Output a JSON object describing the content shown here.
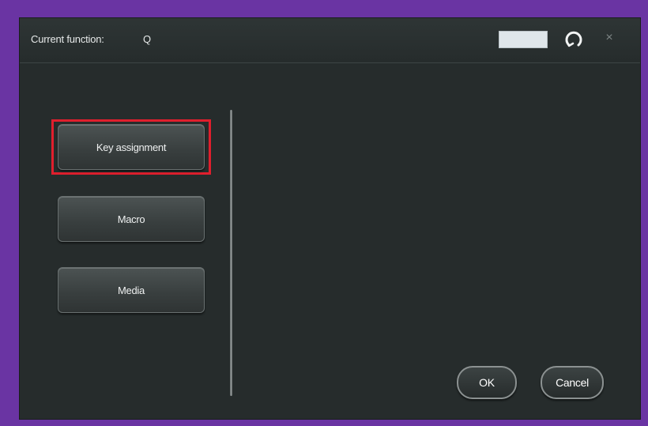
{
  "titlebar": {
    "label": "Current function:",
    "value": "Q"
  },
  "sidebar": {
    "items": [
      {
        "label": "Key assignment"
      },
      {
        "label": "Macro"
      },
      {
        "label": "Media"
      }
    ]
  },
  "footer": {
    "ok_label": "OK",
    "cancel_label": "Cancel"
  },
  "colors": {
    "background": "#6a34a3",
    "window": "#262c2c",
    "highlight": "#e01f2d",
    "swatch": "#dfe6ea"
  },
  "icons": [
    "reset-icon",
    "close-icon"
  ]
}
